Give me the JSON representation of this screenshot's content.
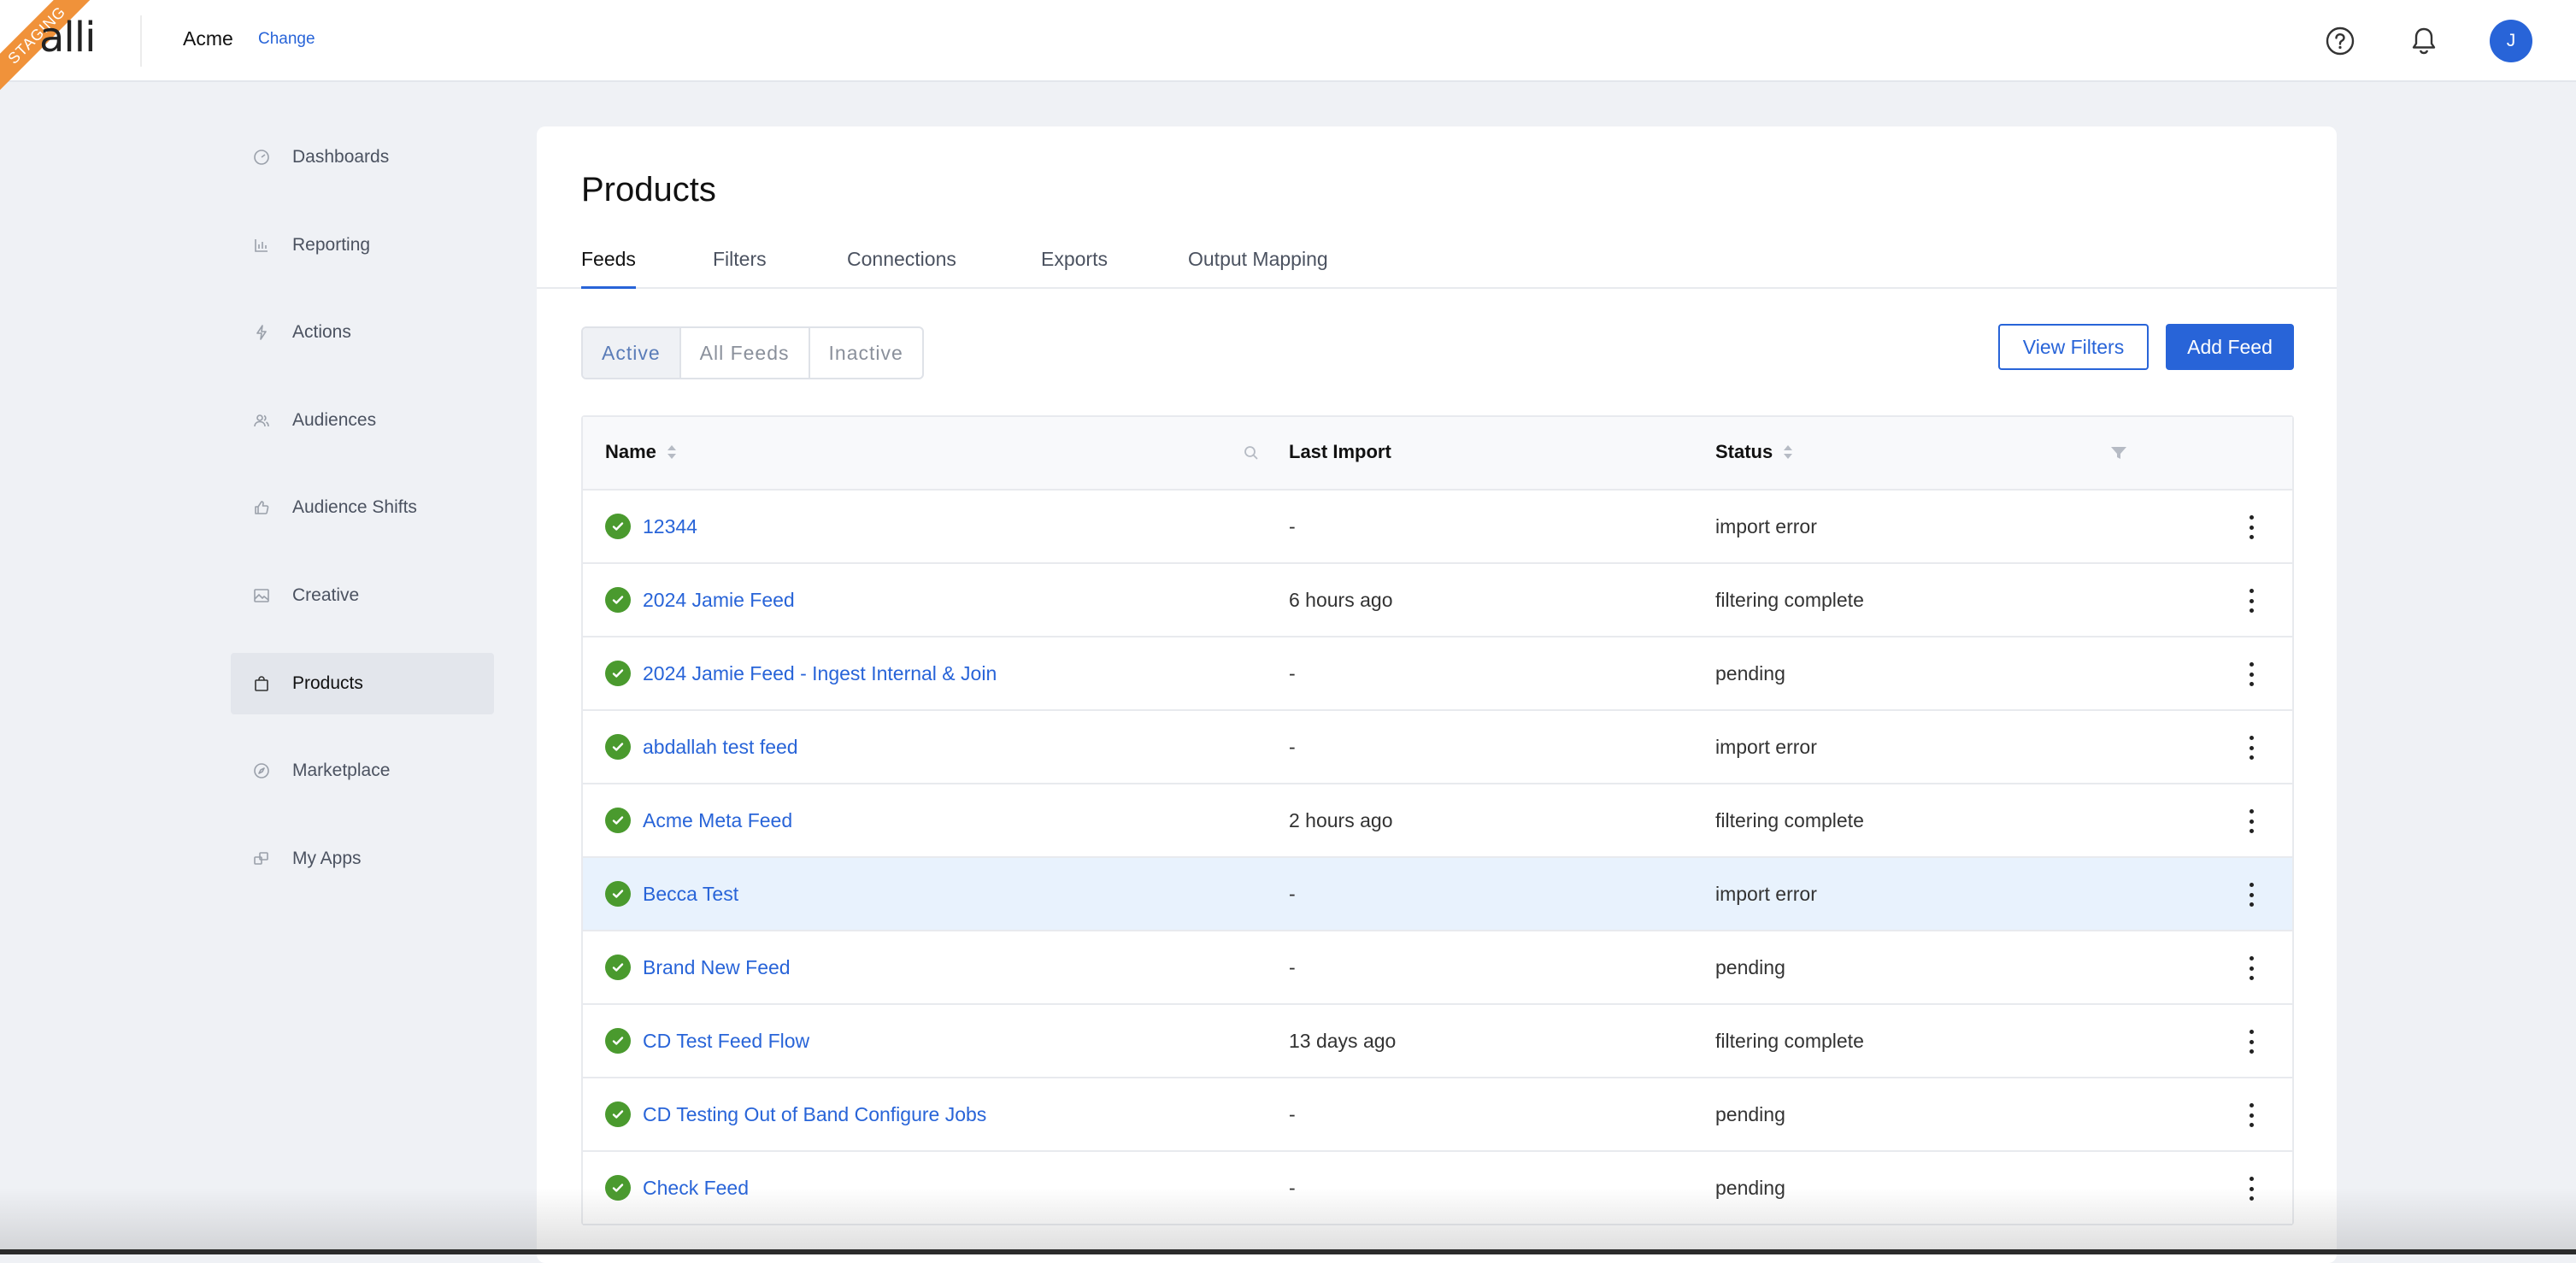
{
  "topbar": {
    "ribbon": "STAGING",
    "logo": "alli",
    "org_name": "Acme",
    "change_label": "Change",
    "avatar_initial": "J",
    "icons": [
      "help-icon",
      "bell-icon"
    ]
  },
  "sidebar": {
    "items": [
      {
        "label": "Dashboards",
        "icon": "dashboard-icon"
      },
      {
        "label": "Reporting",
        "icon": "bar-chart-icon"
      },
      {
        "label": "Actions",
        "icon": "lightning-icon"
      },
      {
        "label": "Audiences",
        "icon": "people-icon"
      },
      {
        "label": "Audience Shifts",
        "icon": "thumbs-up-icon"
      },
      {
        "label": "Creative",
        "icon": "image-icon"
      },
      {
        "label": "Products",
        "icon": "shopping-bag-icon",
        "active": true
      },
      {
        "label": "Marketplace",
        "icon": "compass-icon"
      },
      {
        "label": "My Apps",
        "icon": "apps-icon"
      }
    ]
  },
  "main": {
    "title": "Products",
    "tabs": [
      {
        "label": "Feeds",
        "active": true
      },
      {
        "label": "Filters"
      },
      {
        "label": "Connections"
      },
      {
        "label": "Exports"
      },
      {
        "label": "Output Mapping"
      }
    ],
    "segments": [
      {
        "label": "Active",
        "active": true
      },
      {
        "label": "All Feeds"
      },
      {
        "label": "Inactive"
      }
    ],
    "view_filters_label": "View Filters",
    "add_feed_label": "Add Feed"
  },
  "table": {
    "headers": {
      "name": "Name",
      "last_import": "Last Import",
      "status": "Status"
    },
    "rows": [
      {
        "name": "12344",
        "last_import": "-",
        "status": "import error"
      },
      {
        "name": "2024 Jamie Feed",
        "last_import": "6 hours ago",
        "status": "filtering complete"
      },
      {
        "name": "2024 Jamie Feed - Ingest Internal & Join",
        "last_import": "-",
        "status": "pending"
      },
      {
        "name": "abdallah test feed",
        "last_import": "-",
        "status": "import error"
      },
      {
        "name": "Acme Meta Feed",
        "last_import": "2 hours ago",
        "status": "filtering complete"
      },
      {
        "name": "Becca Test",
        "last_import": "-",
        "status": "import error",
        "highlight": true
      },
      {
        "name": "Brand New Feed",
        "last_import": "-",
        "status": "pending"
      },
      {
        "name": "CD Test Feed Flow",
        "last_import": "13 days ago",
        "status": "filtering complete"
      },
      {
        "name": "CD Testing Out of Band Configure Jobs",
        "last_import": "-",
        "status": "pending"
      },
      {
        "name": "Check Feed",
        "last_import": "-",
        "status": "pending"
      }
    ]
  },
  "colors": {
    "accent": "#2864d8",
    "success": "#4a9a2e",
    "ribbon": "#f0923a",
    "row_highlight": "#e8f2fd"
  }
}
